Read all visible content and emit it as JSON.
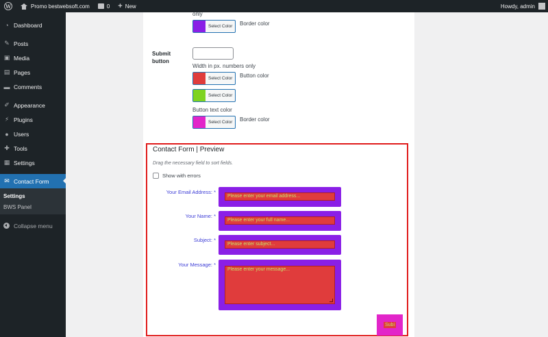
{
  "admin_bar": {
    "site_name": "Promo bestwebsoft.com",
    "comments_count": "0",
    "new_label": "New",
    "greeting": "Howdy, admin"
  },
  "sidebar": {
    "items": [
      {
        "label": "Dashboard",
        "icon": "dashboard-icon"
      },
      {
        "label": "Posts",
        "icon": "pin-icon"
      },
      {
        "label": "Media",
        "icon": "media-icon"
      },
      {
        "label": "Pages",
        "icon": "pages-icon"
      },
      {
        "label": "Comments",
        "icon": "comment-icon"
      },
      {
        "label": "Appearance",
        "icon": "brush-icon"
      },
      {
        "label": "Plugins",
        "icon": "plug-icon"
      },
      {
        "label": "Users",
        "icon": "user-icon"
      },
      {
        "label": "Tools",
        "icon": "wrench-icon"
      },
      {
        "label": "Settings",
        "icon": "settings-icon"
      },
      {
        "label": "Contact Form",
        "icon": "mail-icon"
      }
    ],
    "submenu": [
      "Settings",
      "BWS Panel"
    ],
    "collapse_label": "Collapse menu"
  },
  "settings": {
    "top_only_text": "only",
    "select_color_label": "Select Color",
    "border_color_label": "Border color",
    "submit_button_label": "Submit button",
    "width_input_value": "",
    "width_hint": "Width in px. numbers only",
    "button_color_label": "Button color",
    "button_text_color_label": "Button text color",
    "colors": {
      "border_top": "#8a1fe6",
      "button": "#e03c3c",
      "button_text": "#7ed321",
      "submit_border": "#e225c9"
    }
  },
  "preview": {
    "title": "Contact Form | Preview",
    "hint": "Drag the necessary field to sort fields.",
    "show_errors_label": "Show with errors",
    "show_errors_checked": false,
    "fields": [
      {
        "label": "Your Email Address:",
        "required_mark": "*",
        "placeholder": "Please enter your email address..."
      },
      {
        "label": "Your Name:",
        "required_mark": "*",
        "placeholder": "Please enter your full name..."
      },
      {
        "label": "Subject:",
        "required_mark": "*",
        "placeholder": "Please enter subject..."
      },
      {
        "label": "Your Message:",
        "required_mark": "*",
        "placeholder": "Please enter your message..."
      }
    ],
    "submit_label": "Subi"
  }
}
